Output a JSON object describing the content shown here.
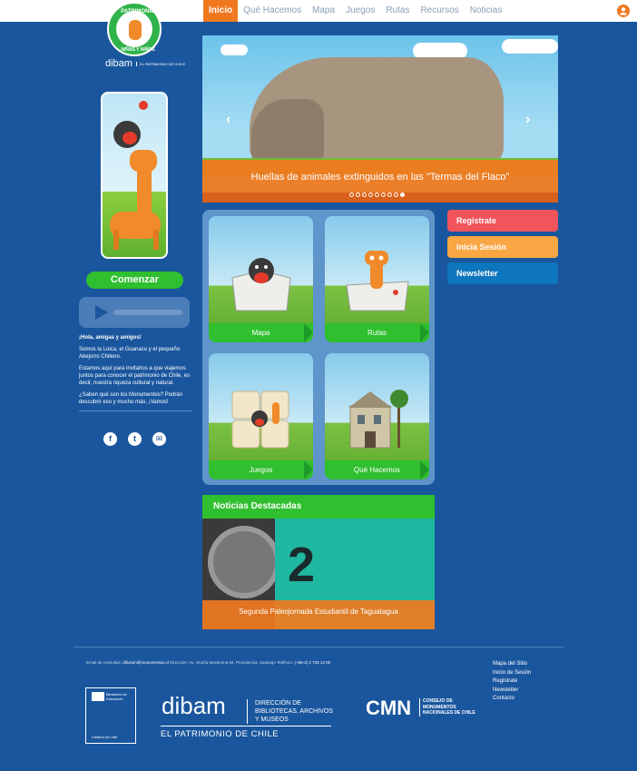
{
  "nav": {
    "items": [
      {
        "label": "Inicio",
        "active": true
      },
      {
        "label": "Qué Hacemos"
      },
      {
        "label": "Mapa"
      },
      {
        "label": "Juegos"
      },
      {
        "label": "Rutas"
      },
      {
        "label": "Recursos"
      },
      {
        "label": "Noticias"
      }
    ]
  },
  "logo": {
    "top": "PATRIMONIO",
    "bottom": "NIÑAS Y NIÑOS",
    "brand": "dibam",
    "brand_sub": "EL PATRIMONIO DE CHILE"
  },
  "sidebar": {
    "start_button": "Comenzar",
    "greeting": "¡Hola, amigas y amigos!",
    "p1": "Somos la Loica, el Guanaco y el pequeño Abejorro Chileno.",
    "p2": "Estamos aquí para invitarlos a que viajemos juntos para conocer el patrimonio de Chile, es decir, nuestra riqueza cultural y natural.",
    "p3": "¿Saben qué son los Monumentos? Podrán descubrir eso y mucho más. ¡Vamos!",
    "social": [
      "f",
      "t",
      "✉"
    ]
  },
  "hero": {
    "caption": "Huellas de animales extinguidos en las \"Termas del Flaco\"",
    "prev": "‹",
    "next": "›",
    "slide_count": 9,
    "active_slide": 9
  },
  "cards": [
    {
      "label": "Mapa"
    },
    {
      "label": "Rutas"
    },
    {
      "label": "Juegos"
    },
    {
      "label": "Qué Hacemos"
    }
  ],
  "actions": {
    "register": "Registrate",
    "login": "Inicia Sesión",
    "newsletter": "Newsletter"
  },
  "news": {
    "title": "Noticias Destacadas",
    "item_caption": "Segunda Paleojornada Estudiantil de Taguatagua",
    "poster_text": "2"
  },
  "footer": {
    "email_label": "Email de consultas:",
    "email": "difusion@monumentos.cl",
    "address_label": "Dirección:",
    "address": "Av. Vicuña Mackenna 84, Providencia, Santiago",
    "phone_label": "Teléfono:",
    "phone": "(+56-2) 2 726 14 00",
    "links": [
      "Mapa del Sitio",
      "Inicio de Sesión",
      "Registrate",
      "Newsletter",
      "Contacto"
    ],
    "mined_title": "Ministerio de Educación",
    "mined_sub": "Gobierno de Chile",
    "dibam": "dibam",
    "dibam_desc": "DIRECCIÓN DE BIBLIOTECAS, ARCHIVOS Y MUSEOS",
    "patrimonio": "EL PATRIMONIO DE CHILE",
    "cmn": "CMN",
    "cmn_desc": "CONSEJO DE MONUMENTOS NACIONALES DE CHILE"
  }
}
